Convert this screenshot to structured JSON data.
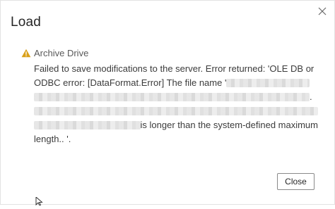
{
  "dialog": {
    "title": "Load",
    "close_icon": "close-icon",
    "warning_icon": "warning-triangle-icon",
    "warning_color": "#d9a01a",
    "source": "Archive Drive",
    "message": {
      "line1": "Failed to save modifications to the server. Error returned: 'OLE DB or",
      "line2_prefix": "ODBC error: [DataFormat.Error] The file name '",
      "line3_suffix": ".",
      "line5_suffix": " is longer than the system-defined maximum",
      "line6": "length.. '."
    },
    "close_button_label": "Close"
  }
}
